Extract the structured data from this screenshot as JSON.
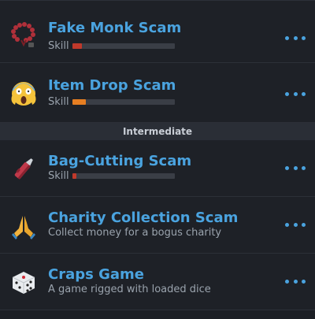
{
  "section_label": "Intermediate",
  "items": [
    {
      "title": "Fake Monk Scam",
      "subtitle": "Skill",
      "icon": "prayer-beads-icon",
      "skill_fraction": 0.09,
      "skill_color": "#c0392b"
    },
    {
      "title": "Item Drop Scam",
      "subtitle": "Skill",
      "icon": "screaming-face-icon",
      "skill_fraction": 0.13,
      "skill_color": "#e67e22"
    },
    {
      "title": "Bag-Cutting Scam",
      "subtitle": "Skill",
      "icon": "box-cutter-icon",
      "skill_fraction": 0.04,
      "skill_color": "#c0392b"
    },
    {
      "title": "Charity Collection Scam",
      "subtitle": "Collect money for a bogus charity",
      "icon": "folded-hands-icon"
    },
    {
      "title": "Craps Game",
      "subtitle": "A game rigged with loaded dice",
      "icon": "dice-icon"
    }
  ],
  "colors": {
    "accent": "#4aa3df",
    "background": "#1e2127",
    "bar_track": "#3a3e46"
  }
}
